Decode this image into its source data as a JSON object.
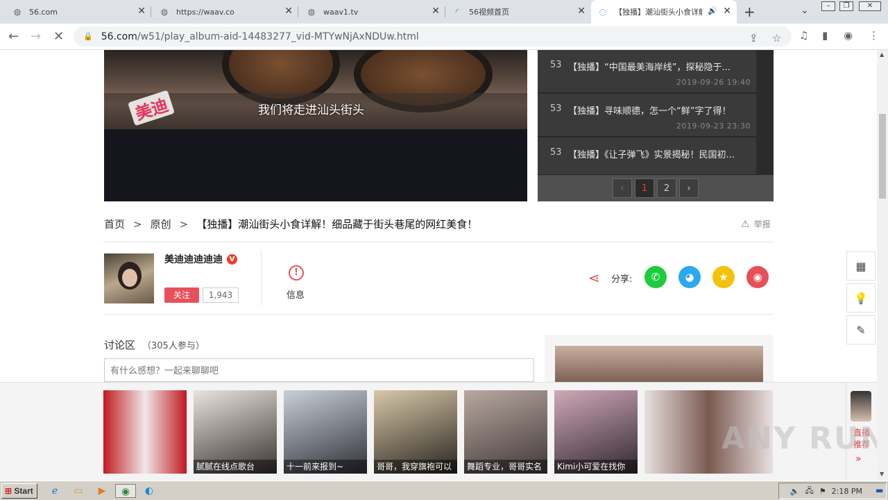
{
  "browser": {
    "tabs": [
      {
        "title": "56.com",
        "icon": "globe-icon",
        "active": false
      },
      {
        "title": "https://waav.co",
        "icon": "globe-icon",
        "active": false
      },
      {
        "title": "waav1.tv",
        "icon": "globe-icon",
        "active": false
      },
      {
        "title": "56视频首页",
        "icon": "loading-icon",
        "active": false
      },
      {
        "title": "【独播】潮汕街头小食详解",
        "icon": "loading-icon",
        "active": true
      }
    ],
    "url_host": "56.com",
    "url_path": "/w51/play_album-aid-14483277_vid-MTYwNjAxNDUw.html"
  },
  "player": {
    "subtitle": "我们将走进汕头街头",
    "logo_text": "美迪"
  },
  "playlist": {
    "items": [
      {
        "num": "53",
        "title": "【独播】“中国最美海岸线”，探秘隐于...",
        "date": "2019-09-26 19:40"
      },
      {
        "num": "53",
        "title": "【独播】寻味顺德，怎一个“鲜”字了得！",
        "date": "2019-09-23 23:30"
      },
      {
        "num": "53",
        "title": "【独播】《让子弹飞》实景揭秘！民国初...",
        "date": ""
      }
    ],
    "pages": [
      "1",
      "2"
    ],
    "current_page": "1",
    "prev": "‹",
    "next": "›"
  },
  "breadcrumb": {
    "home": "首页",
    "category": "原创",
    "title": "【独播】潮汕街头小食详解！细品藏于街头巷尾的网红美食！",
    "report": "举报"
  },
  "uploader": {
    "name": "美迪迪迪迪迪",
    "verified_badge": "V",
    "follow_label": "关注",
    "follower_count": "1,943",
    "info_label": "信息"
  },
  "share": {
    "label": "分享:",
    "services": [
      {
        "name": "wechat",
        "color": "#1ecb3c"
      },
      {
        "name": "qq",
        "color": "#2aa8f0"
      },
      {
        "name": "qzone",
        "color": "#f5c20a"
      },
      {
        "name": "weibo",
        "color": "#e6505a"
      }
    ]
  },
  "discussion": {
    "title": "讨论区",
    "participants": "（305人参与）",
    "placeholder": "有什么感想？一起来聊聊吧"
  },
  "live_strip": {
    "thumbs": [
      {
        "caption": "",
        "colors": [
          "#c01a20",
          "#f0e8e8"
        ]
      },
      {
        "caption": "腻腻在线点歌台",
        "colors": [
          "#e8e4e0",
          "#3a3230"
        ]
      },
      {
        "caption": "十一前来报到~",
        "colors": [
          "#c8d0d8",
          "#303038"
        ]
      },
      {
        "caption": "哥哥，我穿旗袍可以",
        "colors": [
          "#d8c8a8",
          "#282420"
        ]
      },
      {
        "caption": "舞蹈专业，哥哥实名",
        "colors": [
          "#b8a8a0",
          "#403838"
        ]
      },
      {
        "caption": "Kimi小可爱在找你",
        "colors": [
          "#d0a8b8",
          "#302830"
        ]
      },
      {
        "caption": "",
        "colors": [
          "#e8e0e0",
          "#7a5a50"
        ]
      }
    ],
    "live_label": "直播推荐",
    "more_icon": "»"
  },
  "taskbar": {
    "start": "Start",
    "clock": "2:18 PM"
  },
  "watermark": "ANY RUN"
}
